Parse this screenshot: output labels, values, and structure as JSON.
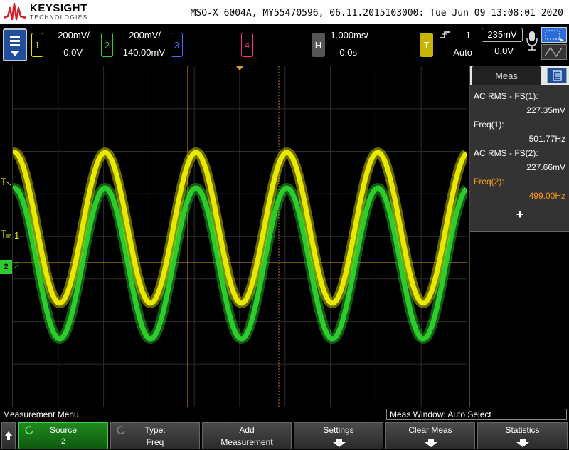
{
  "header": {
    "brand": "KEYSIGHT",
    "brand_sub": "TECHNOLOGIES",
    "title": "MSO-X 6004A, MY55470596, 06.11.2015103000: Tue Jun 09 13:08:01 2020"
  },
  "channels": [
    {
      "num": "1",
      "scale": "200mV/",
      "offset": "0.0V",
      "color": "#e8e800"
    },
    {
      "num": "2",
      "scale": "200mV/",
      "offset": "140.00mV",
      "color": "#2ccc2c"
    },
    {
      "num": "3",
      "color": "#4a6cff"
    },
    {
      "num": "4",
      "color": "#ff2a8a"
    }
  ],
  "horizontal": {
    "key": "H",
    "scale": "1.000ms/",
    "delay": "0.0s"
  },
  "trigger": {
    "key": "T",
    "source": "1",
    "mode": "Auto",
    "level": "235mV",
    "level_value": "0.0V"
  },
  "measurements": {
    "tab_label": "Meas",
    "items": [
      {
        "label": "AC RMS - FS(1):",
        "value": "227.35mV",
        "color": "#ffffff"
      },
      {
        "label": "Freq(1):",
        "value": "501.77Hz",
        "color": "#ffffff"
      },
      {
        "label": "AC RMS - FS(2):",
        "value": "227.66mV",
        "color": "#ffffff"
      },
      {
        "label": "Freq(2):",
        "value": "499.00Hz",
        "color": "#ff9a1a"
      }
    ],
    "add_symbol": "+"
  },
  "markers": {
    "ch1": "1",
    "ch2": "2",
    "ch2_badge": "2"
  },
  "status": {
    "menu_title": "Measurement Menu",
    "meas_window": "Meas Window: Auto Select"
  },
  "softkeys": [
    {
      "top": "Source",
      "bottom": "2"
    },
    {
      "top": "Type:",
      "bottom": "Freq"
    },
    {
      "top": "Add",
      "bottom": "Measurement"
    },
    {
      "top": "Settings",
      "bottom": ""
    },
    {
      "top": "Clear Meas",
      "bottom": ""
    },
    {
      "top": "Statistics",
      "bottom": ""
    }
  ]
}
